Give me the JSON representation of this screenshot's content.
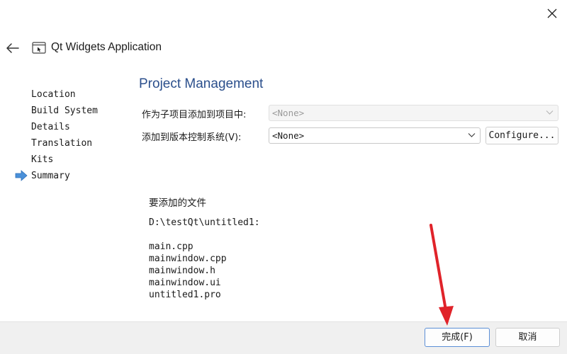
{
  "wizard": {
    "title": "Qt Widgets Application"
  },
  "steps": [
    {
      "label": "Location"
    },
    {
      "label": "Build System"
    },
    {
      "label": "Details"
    },
    {
      "label": "Translation"
    },
    {
      "label": "Kits"
    },
    {
      "label": "Summary",
      "current": true
    }
  ],
  "project_management": {
    "title": "Project Management",
    "add_to_project_label": "作为子项目添加到项目中:",
    "add_to_project_value": "<None>",
    "vcs_label": "添加到版本控制系统(V):",
    "vcs_value": "<None>",
    "configure_label": "Configure..."
  },
  "files": {
    "heading": "要添加的文件",
    "directory": "D:\\testQt\\untitled1:",
    "list": [
      "main.cpp",
      "mainwindow.cpp",
      "mainwindow.h",
      "mainwindow.ui",
      "untitled1.pro"
    ]
  },
  "footer": {
    "finish_label": "完成(F)",
    "cancel_label": "取消"
  },
  "colors": {
    "section_title": "#2b4f8c",
    "current_step_arrow": "#4a90d9",
    "annotation_arrow": "#e0232a",
    "finish_border": "#5c8fd6"
  },
  "icons": {
    "close": "close-icon",
    "back": "back-arrow-icon",
    "app": "application-window-icon",
    "current_step": "current-step-arrow-icon",
    "dropdown": "chevron-down-icon"
  }
}
